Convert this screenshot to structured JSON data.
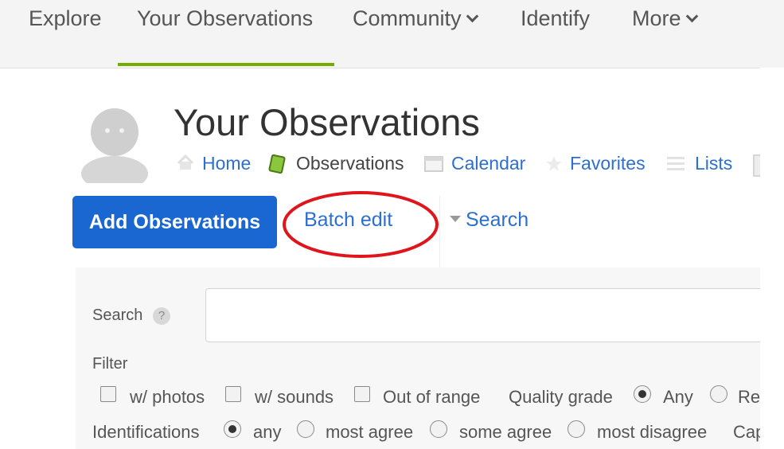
{
  "nav": {
    "explore": "Explore",
    "your_observations": "Your Observations",
    "community": "Community",
    "identify": "Identify",
    "more": "More"
  },
  "header": {
    "title": "Your Observations",
    "subnav": {
      "home": "Home",
      "observations": "Observations",
      "calendar": "Calendar",
      "favorites": "Favorites",
      "lists": "Lists"
    }
  },
  "actions": {
    "add_observations": "Add Observations",
    "batch_edit": "Batch edit",
    "search": "Search"
  },
  "filters": {
    "search_label": "Search",
    "search_value": "",
    "filter_label": "Filter",
    "with_photos": "w/ photos",
    "with_sounds": "w/ sounds",
    "out_of_range": "Out of range",
    "quality_grade_label": "Quality grade",
    "quality_any": "Any",
    "quality_research": "Resea",
    "identifications_label": "Identifications",
    "id_any": "any",
    "id_most_agree": "most agree",
    "id_some_agree": "some agree",
    "id_most_disagree": "most disagree",
    "captive": "Captiv"
  },
  "colors": {
    "accent_green": "#74ac00",
    "button_blue": "#1a67d2",
    "link_blue": "#2d6fd1",
    "annotation_red": "#e0141b"
  }
}
